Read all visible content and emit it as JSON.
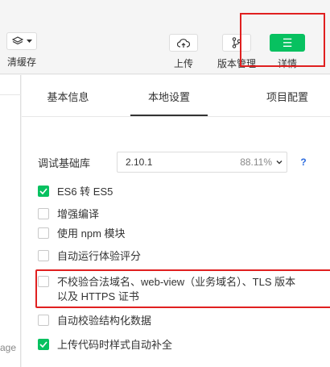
{
  "toolbar": {
    "clear_cache_label": "清缓存",
    "upload_label": "上传",
    "version_label": "版本管理",
    "details_label": "详情",
    "details_icon": "☰"
  },
  "left_strip": {
    "cut_text": "age"
  },
  "tabs": [
    {
      "label": "基本信息",
      "active": false
    },
    {
      "label": "本地设置",
      "active": true
    },
    {
      "label": "项目配置",
      "active": false
    }
  ],
  "library": {
    "label": "调试基础库",
    "version": "2.10.1",
    "percent": "88.11%",
    "help": "?"
  },
  "options": [
    {
      "label": "ES6 转 ES5",
      "checked": true
    },
    {
      "label": "增强编译",
      "checked": false
    },
    {
      "label": "使用 npm 模块",
      "checked": false
    },
    {
      "label": "自动运行体验评分",
      "checked": false
    },
    {
      "label": "不校验合法域名、web-view（业务域名）、TLS 版本以及 HTTPS 证书",
      "checked": false
    },
    {
      "label": "自动校验结构化数据",
      "checked": false
    },
    {
      "label": "上传代码时样式自动补全",
      "checked": true
    }
  ],
  "colors": {
    "accent_green": "#07c160",
    "highlight_red": "#e02020",
    "help_blue": "#2d6cdf"
  }
}
